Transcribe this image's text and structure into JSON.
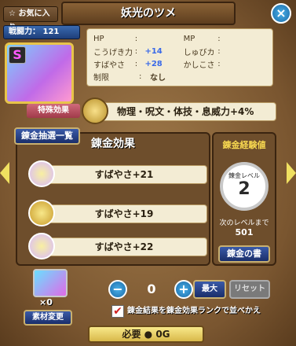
{
  "title": "妖光のツメ",
  "favorite_label": "お気に入り",
  "power": {
    "label": "戦闘力：",
    "value": "121"
  },
  "rank": "S",
  "stats": {
    "hp_label": "HP",
    "hp_value": "",
    "mp_label": "MP",
    "mp_value": "",
    "atk_label": "こうげき力",
    "atk_value": "+14",
    "skill_label": "しゅびカ",
    "skill_value": "",
    "spd_label": "すばやさ",
    "spd_value": "+28",
    "wis_label": "かしこさ",
    "wis_value": "",
    "limit_label": "制限",
    "limit_value": "なし",
    "colon": ":"
  },
  "special": {
    "label": "特殊効果",
    "text": "物理・呪文・体技・息威力+4%"
  },
  "lottery_label": "錬金抽選一覧",
  "effects": {
    "header": "錬金効果",
    "items": [
      "すばやさ+21",
      "すばやさ+19",
      "すばやさ+22"
    ]
  },
  "exp": {
    "title": "錬金経験値",
    "level_label": "錬金レベル",
    "level": "2",
    "next_label": "次のレベルまで",
    "next_value": "501",
    "book_label": "錬金の書"
  },
  "materials": {
    "count": "×0",
    "change_label": "素材変更"
  },
  "stepper": {
    "minus": "−",
    "value": "0",
    "plus": "+"
  },
  "max_label": "最大",
  "reset_label": "リセット",
  "sort_checkbox": {
    "checked": "✔",
    "label": "錬金結果を錬金効果ランクで並べかえ"
  },
  "cost": {
    "label": "必要",
    "value": "0G"
  },
  "colors": {
    "accent_blue": "#1a6aa8",
    "parchment": "#f3ecd4",
    "gold": "#e8c44a"
  }
}
